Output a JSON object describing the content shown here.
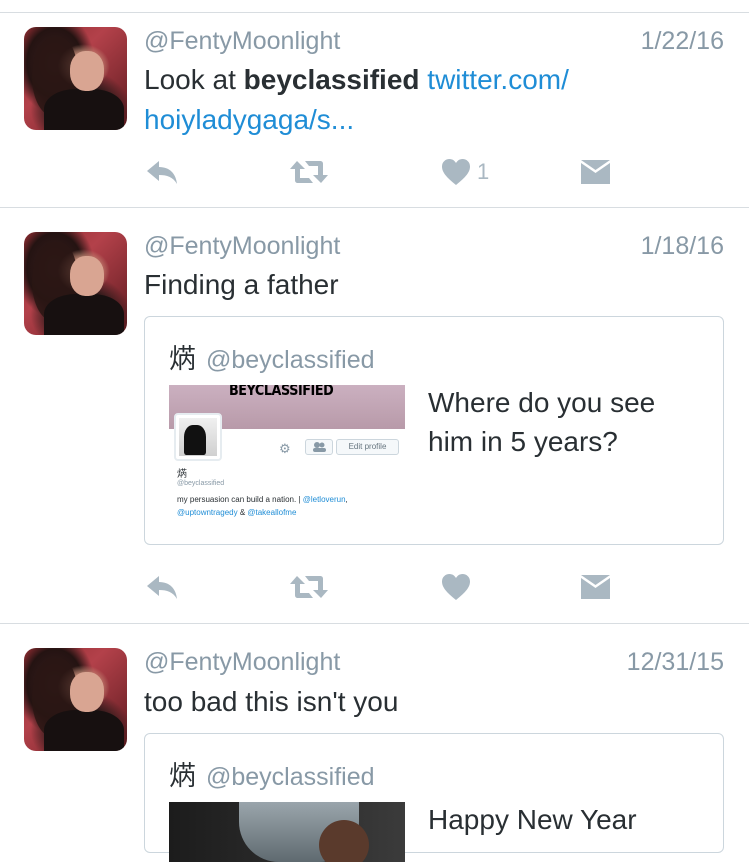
{
  "tweets": [
    {
      "handle": "@FentyMoonlight",
      "date": "1/22/16",
      "text_before": "Look at ",
      "text_bold": "beyclassified",
      "text_space": " ",
      "link": "twitter.com/ hoiyladygaga/s...",
      "like_count": "1"
    },
    {
      "handle": "@FentyMoonlight",
      "date": "1/18/16",
      "text": "Finding a father",
      "quote": {
        "name": "焫",
        "handle": "@beyclassified",
        "text": "Where do you see him in 5 years?",
        "profile_banner_title": "BEYCLASSIFIED",
        "profile_edit_button": "Edit profile",
        "profile_name": "焫",
        "profile_handle": "@beyclassified",
        "profile_bio_1": "my persuasion can build a nation. | ",
        "profile_bio_link_1": "@letloverun",
        "profile_bio_comma": ",",
        "profile_bio_link_2": "@uptowntragedy",
        "profile_bio_amp": " & ",
        "profile_bio_link_3": "@takeallofme"
      }
    },
    {
      "handle": "@FentyMoonlight",
      "date": "12/31/15",
      "text": "too bad this isn't you",
      "quote": {
        "name": "焫",
        "handle": "@beyclassified",
        "text": "Happy New Year"
      }
    }
  ],
  "icons": {
    "reply": "reply-icon",
    "retweet": "retweet-icon",
    "like": "heart-icon",
    "dm": "envelope-icon"
  },
  "colors": {
    "icon_gray": "#aab8c2",
    "link_blue": "#1f8dd6",
    "meta_gray": "#8899a6",
    "text": "#292f33"
  }
}
